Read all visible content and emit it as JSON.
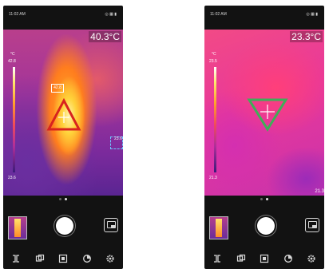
{
  "screens": [
    {
      "status_time": "11:02 AM",
      "status_icons": "◎ ▦ ▮",
      "center_temp": "40.3°C",
      "scale_unit": "°C",
      "scale_max": "42.8",
      "scale_min": "23.6",
      "hot_spot_value": "42.8",
      "cold_spot_value": "23.6",
      "marker_shape": "triangle-up",
      "marker_color": "#d8231e",
      "page_dots_active": 1
    },
    {
      "status_time": "11:02 AM",
      "status_icons": "◎ ▦ ▮",
      "center_temp": "23.3°C",
      "scale_unit": "°C",
      "scale_max": "23.5",
      "scale_min": "21.3",
      "cold_edge_value": "21.3",
      "marker_shape": "triangle-down",
      "marker_color": "#3fae58",
      "page_dots_active": 1
    }
  ],
  "toolbar_icons": [
    "split-view-icon",
    "palette-icon",
    "crop-icon",
    "measure-icon",
    "settings-icon"
  ],
  "colors": {
    "phone_bg": "#121212",
    "icon": "#d8d8d8"
  }
}
